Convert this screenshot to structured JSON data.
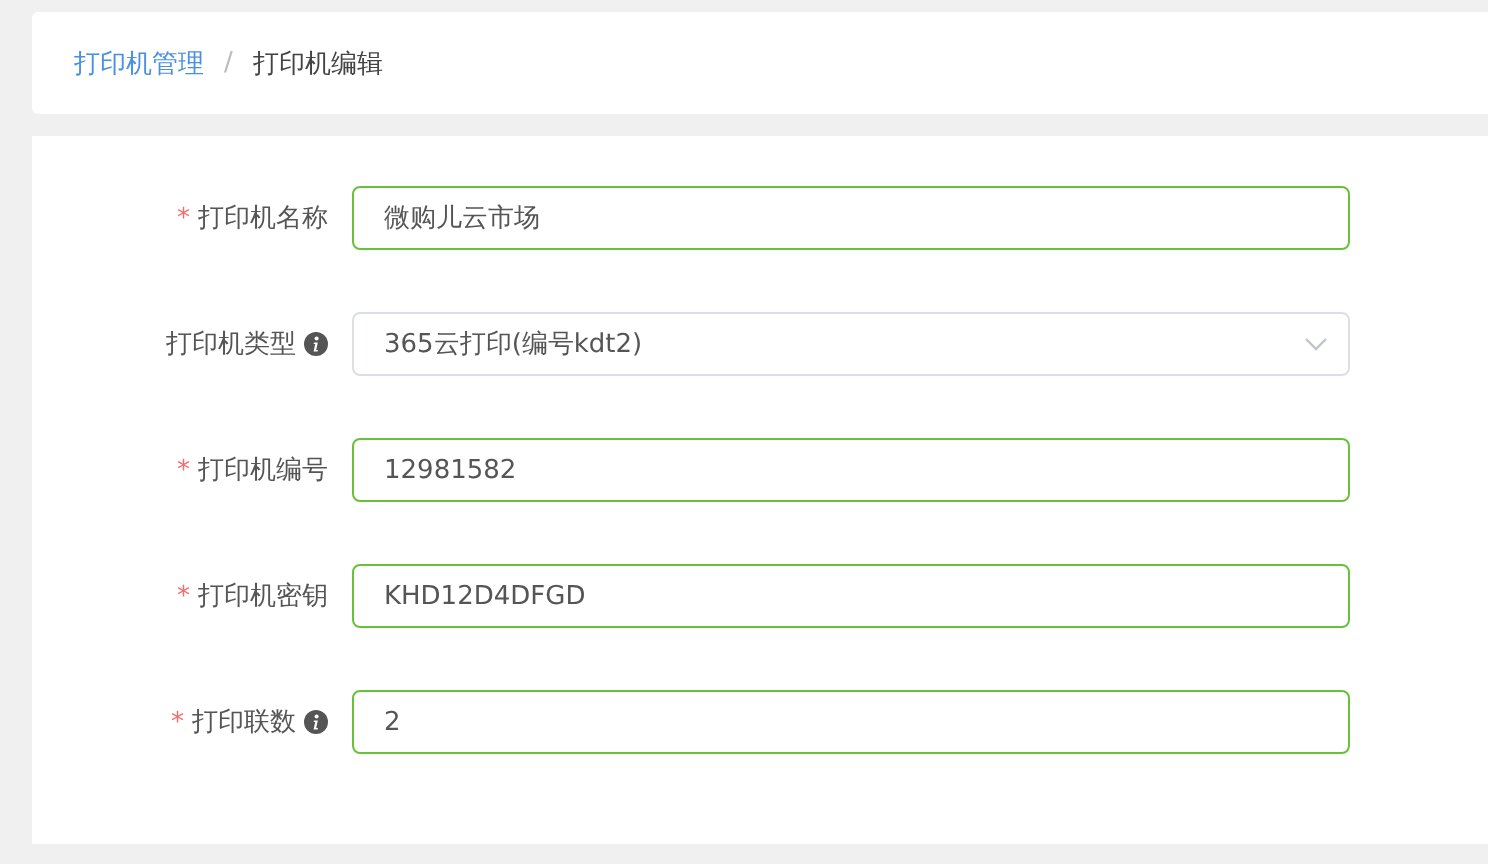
{
  "breadcrumb": [
    {
      "label": "打印机管理",
      "link": true
    },
    {
      "label": "打印机编辑",
      "link": false
    }
  ],
  "breadcrumb_separator": "/",
  "form": {
    "fields": [
      {
        "label": "打印机名称",
        "kind": "input",
        "required_mark": "*",
        "info": false,
        "value": "微购儿云市场"
      },
      {
        "label": "打印机类型",
        "kind": "select",
        "info": true,
        "value": "365云打印(编号kdt2)"
      },
      {
        "label": "打印机编号",
        "kind": "input",
        "required_mark": "*",
        "info": false,
        "value": "12981582"
      },
      {
        "label": "打印机密钥",
        "kind": "input",
        "required_mark": "*",
        "info": false,
        "value": "KHD12D4DFGD"
      },
      {
        "label": "打印联数",
        "kind": "input",
        "required_mark": "*",
        "info": true,
        "value": "2"
      }
    ]
  }
}
